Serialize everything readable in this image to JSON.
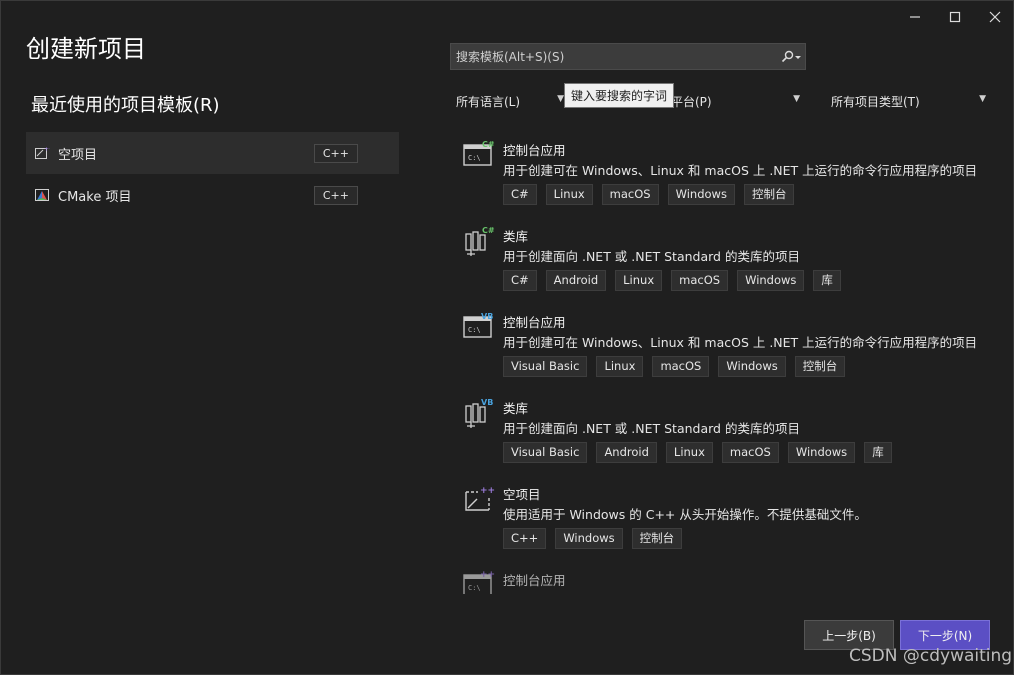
{
  "window": {
    "title": "创建新项目",
    "controls": {
      "minimize_icon": "minimize-icon",
      "maximize_icon": "maximize-icon",
      "close_icon": "close-icon"
    }
  },
  "recent": {
    "heading": "最近使用的项目模板(R)",
    "items": [
      {
        "label": "空项目",
        "lang": "C++",
        "icon": "empty-project-icon",
        "selected": true
      },
      {
        "label": "CMake 项目",
        "lang": "C++",
        "icon": "cmake-icon",
        "selected": false
      }
    ]
  },
  "search": {
    "placeholder": "搜索模板(Alt+S)(S)",
    "icon": "search-icon",
    "tooltip": "键入要搜索的字词"
  },
  "filters": {
    "language": "所有语言(L)",
    "platform": "平台(P)",
    "project_type": "所有项目类型(T)"
  },
  "templates": [
    {
      "name": "控制台应用",
      "badge": "C#",
      "icon": "console-app-icon",
      "desc": "用于创建可在 Windows、Linux 和 macOS 上 .NET 上运行的命令行应用程序的项目",
      "tags": [
        "C#",
        "Linux",
        "macOS",
        "Windows",
        "控制台"
      ]
    },
    {
      "name": "类库",
      "badge": "C#",
      "icon": "class-library-icon",
      "desc": "用于创建面向 .NET 或 .NET Standard 的类库的项目",
      "tags": [
        "C#",
        "Android",
        "Linux",
        "macOS",
        "Windows",
        "库"
      ]
    },
    {
      "name": "控制台应用",
      "badge": "VB",
      "icon": "console-app-icon",
      "desc": "用于创建可在 Windows、Linux 和 macOS 上 .NET 上运行的命令行应用程序的项目",
      "tags": [
        "Visual Basic",
        "Linux",
        "macOS",
        "Windows",
        "控制台"
      ]
    },
    {
      "name": "类库",
      "badge": "VB",
      "icon": "class-library-icon",
      "desc": "用于创建面向 .NET 或 .NET Standard 的类库的项目",
      "tags": [
        "Visual Basic",
        "Android",
        "Linux",
        "macOS",
        "Windows",
        "库"
      ]
    },
    {
      "name": "空项目",
      "badge": "++",
      "icon": "empty-project-icon",
      "desc": "使用适用于 Windows 的 C++ 从头开始操作。不提供基础文件。",
      "tags": [
        "C++",
        "Windows",
        "控制台"
      ]
    },
    {
      "name": "控制台应用",
      "badge": "++",
      "icon": "console-app-icon",
      "desc": "",
      "tags": []
    }
  ],
  "buttons": {
    "back": "上一步(B)",
    "next": "下一步(N)"
  },
  "watermark": "CSDN @cdywaiting",
  "colors": {
    "accent": "#5b4fc4",
    "background": "#1f1f1f",
    "csharp": "#68c36a",
    "vb": "#4aa3df",
    "cpp": "#9a7bd8"
  }
}
